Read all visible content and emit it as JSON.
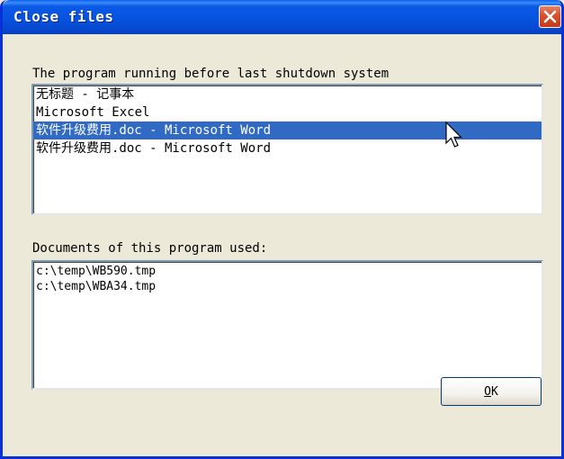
{
  "window": {
    "title": "Close files",
    "close_icon": "close-icon"
  },
  "colors": {
    "titlebar": "#0653e0",
    "selection": "#316ac5",
    "close_button": "#d9532f",
    "dialog_bg": "#ece9d8"
  },
  "programs": {
    "label": "The program running before last shutdown system",
    "items": [
      {
        "label": "无标题 - 记事本",
        "selected": false
      },
      {
        "label": "Microsoft Excel",
        "selected": false
      },
      {
        "label": "软件升级费用.doc - Microsoft Word",
        "selected": true
      },
      {
        "label": "软件升级费用.doc - Microsoft Word",
        "selected": false
      }
    ]
  },
  "documents": {
    "label": "Documents of this program used:",
    "items": [
      "c:\\temp\\WB590.tmp",
      "c:\\temp\\WBA34.tmp"
    ]
  },
  "ok_button": {
    "mnemonic": "O",
    "rest": "K"
  }
}
